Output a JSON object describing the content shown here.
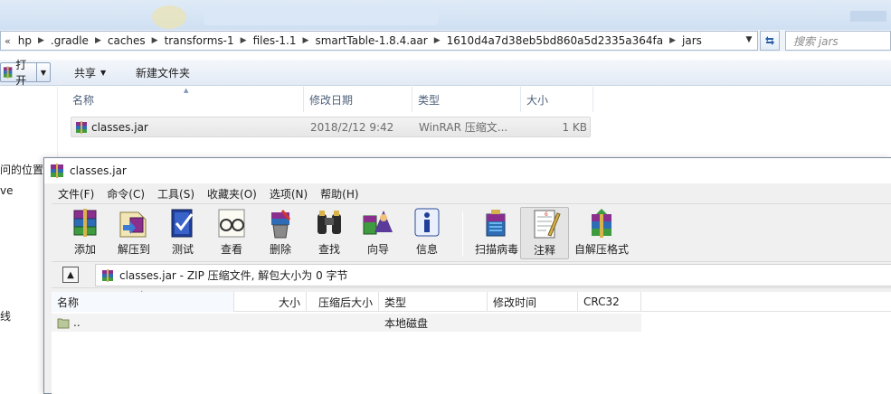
{
  "explorer": {
    "address": {
      "lead": "«",
      "segments": [
        "hp",
        ".gradle",
        "caches",
        "transforms-1",
        "files-1.1",
        "smartTable-1.8.4.aar",
        "1610d4a7d38eb5bd860a5d2335a364fa",
        "jars"
      ],
      "search_placeholder": "搜索 jars"
    },
    "toolbar": {
      "open_label": "打开",
      "share_label": "共享",
      "new_folder_label": "新建文件夹"
    },
    "left_pane": {
      "items": [
        "问的位置",
        "ve",
        "线"
      ]
    },
    "columns": {
      "name": "名称",
      "modified": "修改日期",
      "type": "类型",
      "size": "大小"
    },
    "files": [
      {
        "name": "classes.jar",
        "modified": "2018/2/12 9:42",
        "type": "WinRAR 压缩文...",
        "size": "1 KB"
      }
    ]
  },
  "winrar": {
    "title": "classes.jar",
    "menu": [
      "文件(F)",
      "命令(C)",
      "工具(S)",
      "收藏夹(O)",
      "选项(N)",
      "帮助(H)"
    ],
    "tools": [
      "添加",
      "解压到",
      "测试",
      "查看",
      "删除",
      "查找",
      "向导",
      "信息",
      "扫描病毒",
      "注释",
      "自解压格式"
    ],
    "path_text": "classes.jar - ZIP 压缩文件, 解包大小为 0 字节",
    "columns": {
      "name": "名称",
      "size": "大小",
      "packed": "压缩后大小",
      "type": "类型",
      "modified": "修改时间",
      "crc": "CRC32"
    },
    "rows": [
      {
        "name": "..",
        "type": "本地磁盘"
      }
    ]
  },
  "colors": {
    "accent": "#2a5fa8",
    "header_text": "#4c607a",
    "selection": "#f3f3f3"
  }
}
